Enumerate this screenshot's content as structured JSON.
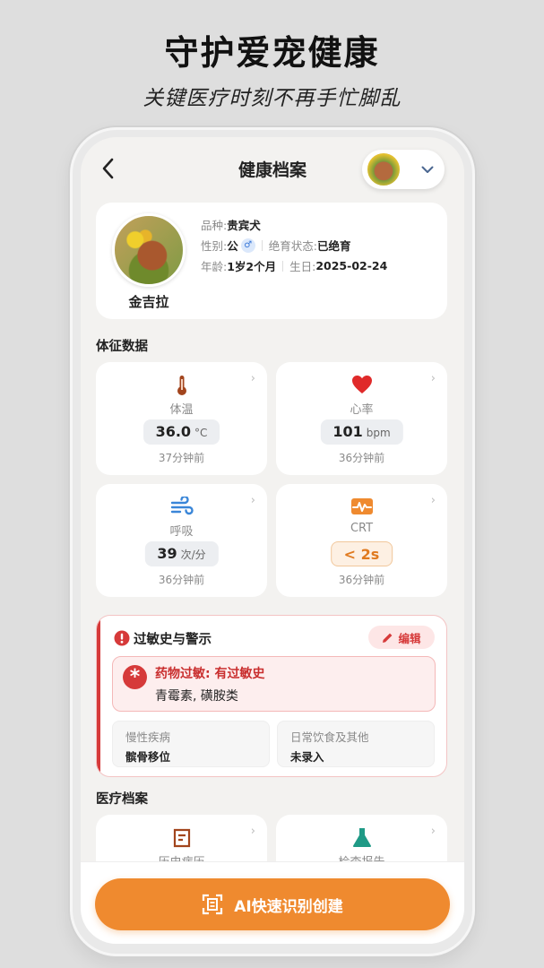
{
  "promo": {
    "title": "守护爱宠健康",
    "subtitle": "关键医疗时刻不再手忙脚乱"
  },
  "header": {
    "title": "健康档案"
  },
  "pet": {
    "name": "金吉拉",
    "breed_label": "品种:",
    "breed": "贵宾犬",
    "gender_label": "性别:",
    "gender": "公",
    "gender_symbol": "♂",
    "neuter_label": "绝育状态:",
    "neuter": "已绝育",
    "age_label": "年龄:",
    "age": "1岁2个月",
    "birthday_label": "生日:",
    "birthday": "2025-02-24"
  },
  "vitals": {
    "section_title": "体征数据",
    "items": [
      {
        "name": "体温",
        "value": "36.0",
        "unit": "°C",
        "time": "37分钟前",
        "icon": "thermometer-icon"
      },
      {
        "name": "心率",
        "value": "101",
        "unit": "bpm",
        "time": "36分钟前",
        "icon": "heart-icon"
      },
      {
        "name": "呼吸",
        "value": "39",
        "unit": "次/分",
        "time": "36分钟前",
        "icon": "wind-icon"
      },
      {
        "name": "CRT",
        "value": "< 2s",
        "unit": "",
        "time": "36分钟前",
        "icon": "pulse-icon"
      }
    ]
  },
  "allergy": {
    "title": "过敏史与警示",
    "edit_label": "编辑",
    "drug_title": "药物过敏: 有过敏史",
    "drug_detail": "青霉素, 磺胺类",
    "chronic_label": "慢性疾病",
    "chronic_value": "髌骨移位",
    "diet_label": "日常饮食及其他",
    "diet_value": "未录入"
  },
  "records": {
    "section_title": "医疗档案",
    "items": [
      {
        "name": "历史病历",
        "icon": "medical-record-icon"
      },
      {
        "name": "检查报告",
        "icon": "flask-icon"
      }
    ]
  },
  "bottom": {
    "ai_button_label": "AI快速识别创建"
  },
  "colors": {
    "accent": "#ef8a2f",
    "alert": "#d63a3a",
    "background": "#f3f2f0"
  }
}
